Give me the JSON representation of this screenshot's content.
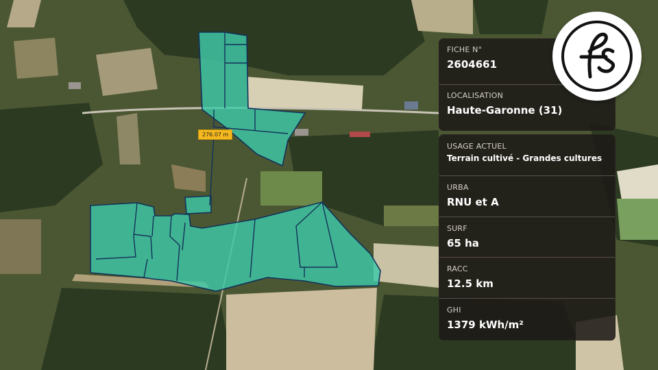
{
  "map": {
    "scale_label": "276.07 m"
  },
  "info": {
    "fiche": {
      "label": "FICHE N°",
      "value": "2604661"
    },
    "localisation": {
      "label": "LOCALISATION",
      "value": "Haute-Garonne (31)"
    },
    "usage": {
      "label": "USAGE ACTUEL",
      "value": "Terrain cultivé - Grandes cultures"
    },
    "urba": {
      "label": "URBA",
      "value": "RNU et A"
    },
    "surf": {
      "label": "SURF",
      "value": "65 ha"
    },
    "racc": {
      "label": "RACC",
      "value": "12.5 km"
    },
    "ghi": {
      "label": "GHI",
      "value": "1379 kWh/m²"
    }
  },
  "logo": {
    "monogram": "fs"
  },
  "colors": {
    "parcel_fill": "#3ec9a7",
    "parcel_outline": "#13305a",
    "panel_bg": "#1c1816",
    "badge": "#f5b81e"
  }
}
